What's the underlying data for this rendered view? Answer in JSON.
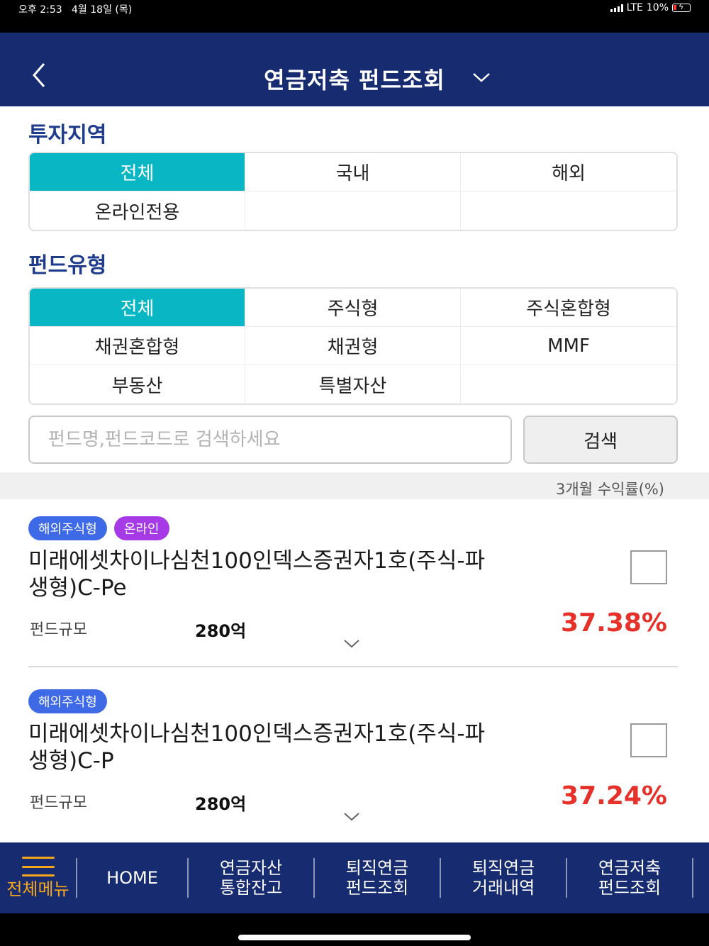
{
  "status_bar": {
    "time": "오후 2:53",
    "date": "4월 18일 (목)",
    "network": "LTE",
    "battery": "10%"
  },
  "header": {
    "title": "연금저축 펀드조회",
    "back_icon": "chevron-left-icon",
    "dropdown_icon": "chevron-down-icon"
  },
  "region": {
    "label": "투자지역",
    "options": [
      "전체",
      "국내",
      "해외",
      "온라인전용",
      "",
      ""
    ],
    "selected": "전체"
  },
  "fund_type": {
    "label": "펀드유형",
    "options": [
      "전체",
      "주식형",
      "주식혼합형",
      "채권혼합형",
      "채권형",
      "MMF",
      "부동산",
      "특별자산",
      ""
    ],
    "selected": "전체"
  },
  "search": {
    "placeholder": "펀드명,펀드코드로 검색하세요",
    "value": "",
    "button_label": "검색"
  },
  "list_header": {
    "return_label": "3개월 수익률(%)"
  },
  "funds": [
    {
      "badges": [
        "해외주식형",
        "온라인"
      ],
      "name": "미래에셋차이나심천100인덱스증권자1호(주식-파생형)C-Pe",
      "size_label": "펀드규모",
      "size_value": "280억",
      "return": "37.38%",
      "checked": false
    },
    {
      "badges": [
        "해외주식형"
      ],
      "name": "미래에셋차이나심천100인덱스증권자1호(주식-파생형)C-P",
      "size_label": "펀드규모",
      "size_value": "280억",
      "return": "37.24%",
      "checked": false
    }
  ],
  "bottom_nav": {
    "menu_label": "전체메뉴",
    "items": [
      {
        "line1": "HOME",
        "line2": ""
      },
      {
        "line1": "연금자산",
        "line2": "통합잔고"
      },
      {
        "line1": "퇴직연금",
        "line2": "펀드조회"
      },
      {
        "line1": "퇴직연금",
        "line2": "거래내역"
      },
      {
        "line1": "연금저축",
        "line2": "펀드조회"
      }
    ]
  },
  "colors": {
    "header_bg": "#172b70",
    "selected_bg": "#08b7c3",
    "return_red": "#e53129",
    "menu_orange": "#f6a61b",
    "badge_blue": "#3e6ae8",
    "badge_purple": "#a53ae6"
  }
}
